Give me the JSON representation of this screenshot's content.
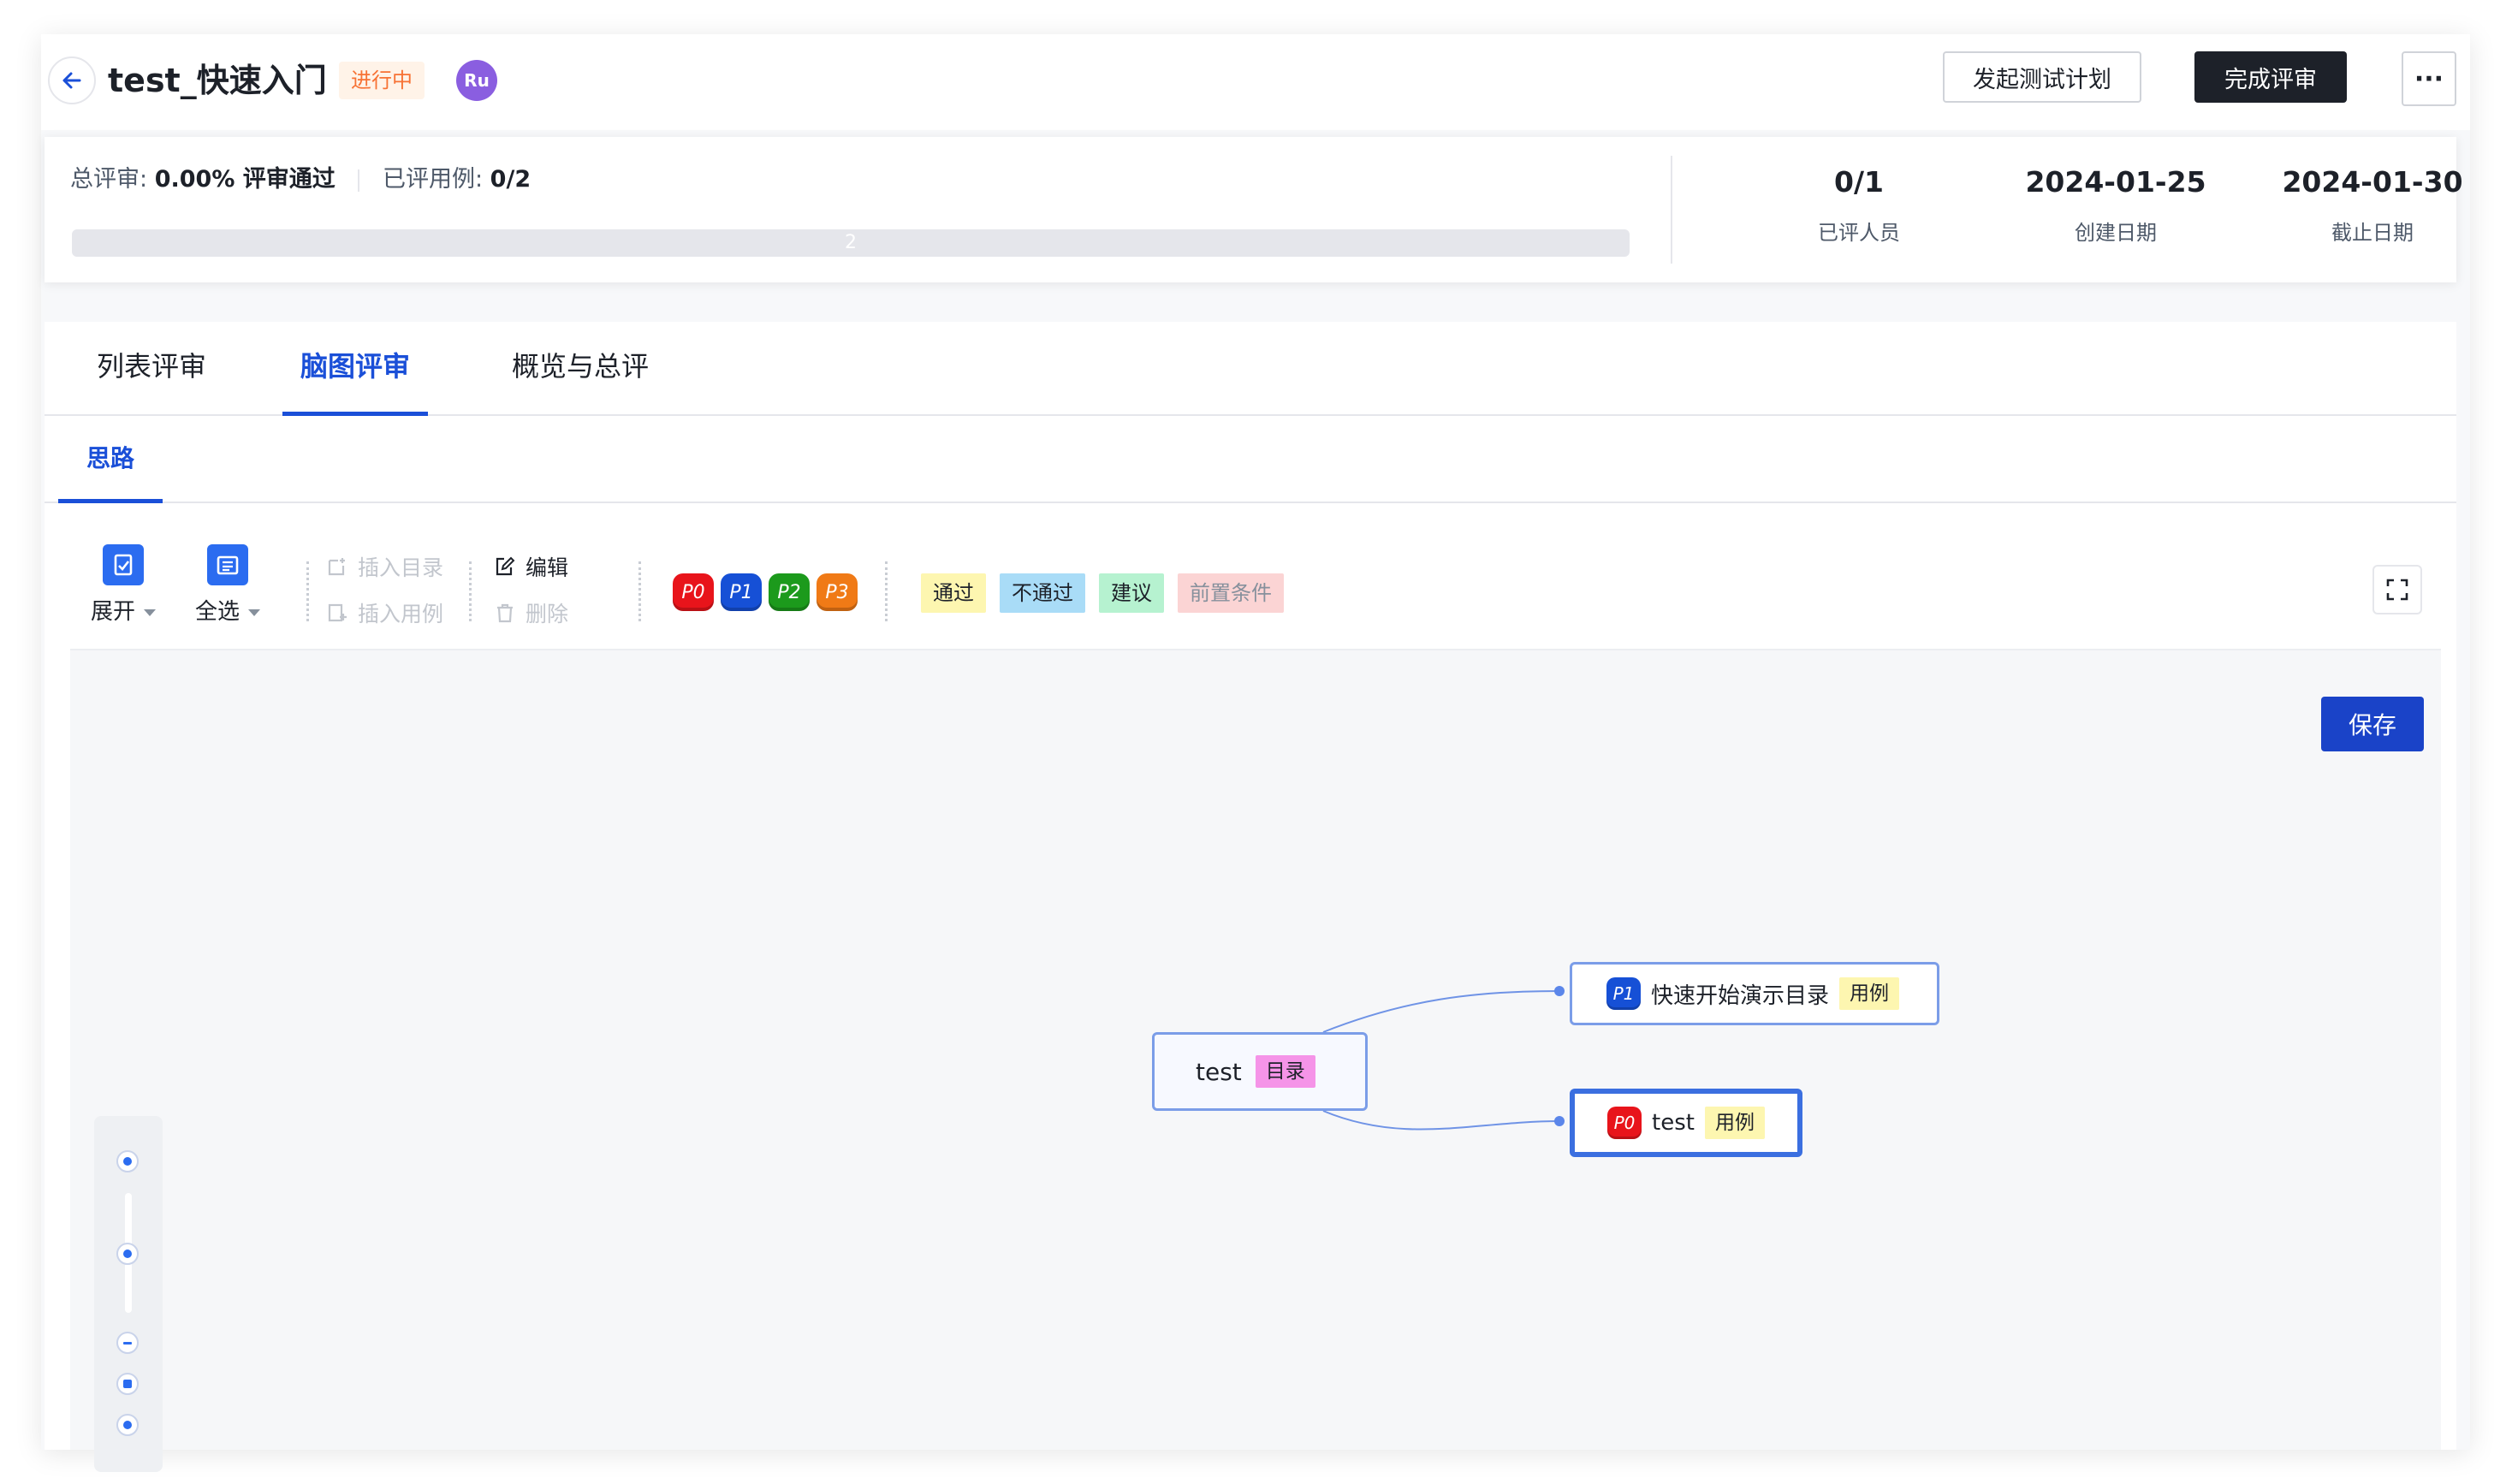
{
  "header": {
    "title": "test_快速入门",
    "status": "进行中",
    "avatar_initials": "Ru",
    "btn_start_plan": "发起测试计划",
    "btn_finish_review": "完成评审",
    "btn_more": "···"
  },
  "stats": {
    "total_label": "总评审:",
    "total_value": "0.00% 评审通过",
    "reviewed_cases_label": "已评用例:",
    "reviewed_cases_value": "0/2",
    "progress_text": "2",
    "progress_value": 0,
    "reviewers_value": "0/1",
    "reviewers_label": "已评人员",
    "created_value": "2024-01-25",
    "created_label": "创建日期",
    "deadline_value": "2024-01-30",
    "deadline_label": "截止日期"
  },
  "tabs": [
    {
      "label": "列表评审",
      "active": false
    },
    {
      "label": "脑图评审",
      "active": true
    },
    {
      "label": "概览与总评",
      "active": false
    }
  ],
  "subtab": "思路",
  "toolbar": {
    "expand": "展开",
    "select_all": "全选",
    "insert_dir": "插入目录",
    "insert_case": "插入用例",
    "edit": "编辑",
    "delete": "删除",
    "priorities": [
      {
        "label": "P0",
        "color": "#e8141b"
      },
      {
        "label": "P1",
        "color": "#1650d6"
      },
      {
        "label": "P2",
        "color": "#1c9a1c"
      },
      {
        "label": "P3",
        "color": "#f07a16"
      }
    ],
    "tags": [
      {
        "label": "通过",
        "bg": "#fdf6b0",
        "color": "#1d2129"
      },
      {
        "label": "不通过",
        "bg": "#a9dcf7",
        "color": "#1d2129"
      },
      {
        "label": "建议",
        "bg": "#b6f2d0",
        "color": "#1d2129"
      },
      {
        "label": "前置条件",
        "bg": "#fbd4d4",
        "color": "#86909c"
      }
    ]
  },
  "save_label": "保存",
  "mindmap": {
    "root": {
      "text": "test",
      "tag": "目录",
      "tag_bg": "#f594e8"
    },
    "children": [
      {
        "priority": "P1",
        "priority_color": "#1650d6",
        "text": "快速开始演示目录",
        "tag": "用例",
        "tag_bg": "#fdf6b0",
        "selected": false
      },
      {
        "priority": "P0",
        "priority_color": "#e8141b",
        "text": "test",
        "tag": "用例",
        "tag_bg": "#fdf6b0",
        "selected": true
      }
    ]
  },
  "colors": {
    "accent": "#1a4fd8",
    "dark_button": "#1d2129",
    "status_orange": "#f77234",
    "avatar": "#8a5ee0"
  }
}
